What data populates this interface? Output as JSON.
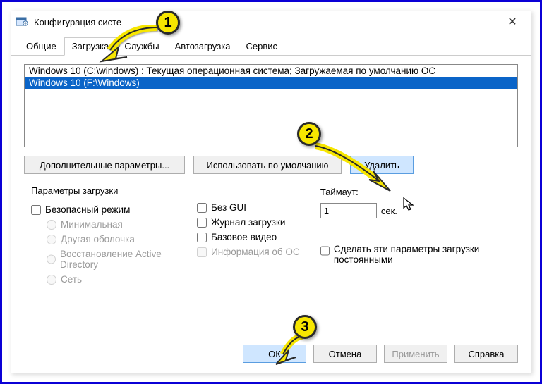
{
  "window": {
    "title": "Конфигурация систе"
  },
  "tabs": {
    "general": "Общие",
    "boot": "Загрузка",
    "services": "Службы",
    "startup": "Автозагрузка",
    "tools": "Сервис"
  },
  "boot_entries": [
    "Windows 10 (C:\\windows) : Текущая операционная система; Загружаемая по умолчанию ОС",
    "Windows 10 (F:\\Windows)"
  ],
  "buttons": {
    "advanced": "Дополнительные параметры...",
    "set_default": "Использовать по умолчанию",
    "delete": "Удалить",
    "ok": "ОК",
    "cancel": "Отмена",
    "apply": "Применить",
    "help": "Справка"
  },
  "boot_options": {
    "group_label": "Параметры загрузки",
    "safe_boot": "Безопасный режим",
    "minimal": "Минимальная",
    "altshell": "Другая оболочка",
    "dsrepair": "Восстановление Active Directory",
    "network": "Сеть",
    "no_gui": "Без GUI",
    "boot_log": "Журнал загрузки",
    "base_video": "Базовое видео",
    "os_info": "Информация  об ОС",
    "timeout_label": "Таймаут:",
    "timeout_value": "1",
    "timeout_unit": "сек.",
    "permanent": "Сделать эти параметры загрузки постоянными"
  },
  "annotations": {
    "b1": "1",
    "b2": "2",
    "b3": "3"
  }
}
